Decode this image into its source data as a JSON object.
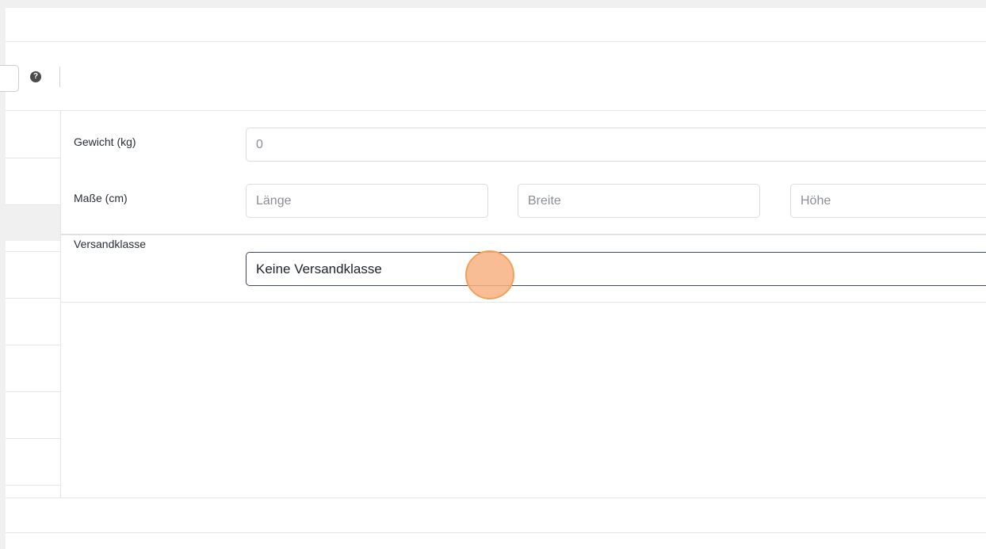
{
  "toolbar": {
    "help_icon_glyph": "?"
  },
  "shipping": {
    "weight_label": "Gewicht (kg)",
    "weight_placeholder": "0",
    "dimensions_label": "Maße (cm)",
    "length_placeholder": "Länge",
    "width_placeholder": "Breite",
    "height_placeholder": "Höhe",
    "shipping_class_label": "Versandklasse",
    "shipping_class_value": "Keine Versandklasse"
  },
  "colors": {
    "page_background": "#f0f0f1",
    "panel_background": "#ffffff",
    "border": "#e3e5e8",
    "cursor_highlight": "#f8b282"
  }
}
